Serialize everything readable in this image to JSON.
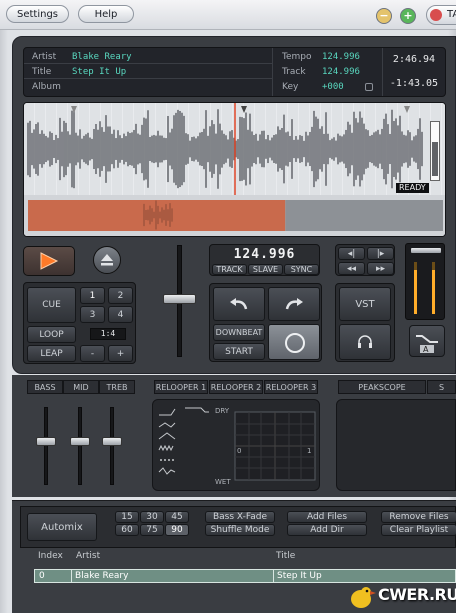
{
  "top_bar": {
    "settings_label": "Settings",
    "help_label": "Help",
    "tab_label": "TA"
  },
  "track_info": {
    "artist_label": "Artist",
    "artist_value": "Blake Reary",
    "title_label": "Title",
    "title_value": "Step It Up",
    "album_label": "Album",
    "album_value": "",
    "tempo_label": "Tempo",
    "tempo_value": "124.996",
    "track_label": "Track",
    "track_value": "124.996",
    "key_label": "Key",
    "key_value": "+000",
    "elapsed": "2:46.94",
    "remaining": "-1:43.05"
  },
  "waveform": {
    "ready_label": "READY",
    "played_fraction": 0.62
  },
  "bpm": {
    "display": "124.996",
    "track_label": "TRACK",
    "slave_label": "SLAVE",
    "sync_label": "SYNC"
  },
  "cue_panel": {
    "cue_label": "CUE",
    "loop_label": "LOOP",
    "leap_label": "LEAP",
    "loop_display": "1:4",
    "minus_label": "-",
    "plus_label": "+",
    "nums": [
      "1",
      "2",
      "3",
      "4"
    ]
  },
  "transport": {
    "downbeat_label": "DOWNBEAT",
    "start_label": "START"
  },
  "vst_label": "VST",
  "eq": {
    "bass_label": "BASS",
    "mid_label": "MID",
    "treb_label": "TREB"
  },
  "relooper": {
    "tab1": "RELOOPER 1",
    "tab2": "RELOOPER 2",
    "tab3": "RELOOPER 3",
    "dry_label": "DRY",
    "wet_label": "WET",
    "zero_label": "0",
    "one_label": "1"
  },
  "peakscope_label": "PEAKSCOPE",
  "peakscope_tab2": "S",
  "playlist": {
    "automix_label": "Automix",
    "times": [
      "15",
      "30",
      "45",
      "60",
      "75",
      "90"
    ],
    "bass_xfade_label": "Bass X-Fade",
    "shuffle_label": "Shuffle Mode",
    "add_files_label": "Add Files",
    "add_dir_label": "Add Dir",
    "remove_files_label": "Remove Files",
    "clear_playlist_label": "Clear Playlist",
    "col_index": "Index",
    "col_artist": "Artist",
    "col_title": "Title",
    "rows": [
      {
        "index": "0",
        "artist": "Blake Reary",
        "title": "Step It Up"
      }
    ]
  },
  "watermark": "CWER.RU",
  "colors": {
    "accent": "#59d7bf",
    "play": "#ff7a28",
    "waveform_played": "#c96a4c"
  }
}
